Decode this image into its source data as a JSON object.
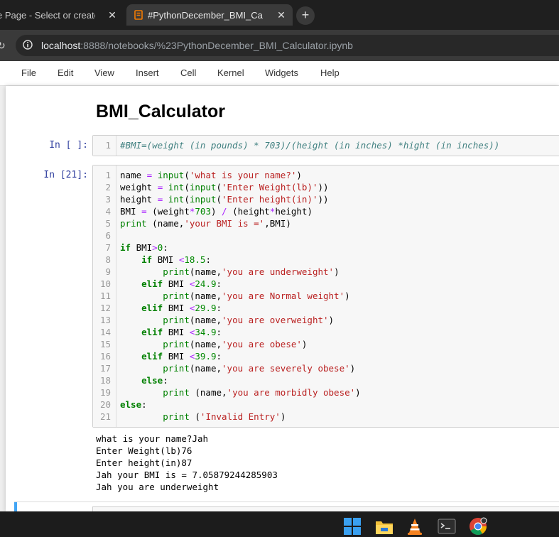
{
  "browser": {
    "tabs": [
      {
        "title": "e Page - Select or create a",
        "close": "✕"
      },
      {
        "title": "#PythonDecember_BMI_Calculat",
        "close": "✕"
      }
    ],
    "new_tab": "+",
    "url_host": "localhost",
    "url_rest": ":8888/notebooks/%23PythonDecember_BMI_Calculator.ipynb"
  },
  "menu": [
    "File",
    "Edit",
    "View",
    "Insert",
    "Cell",
    "Kernel",
    "Widgets",
    "Help"
  ],
  "notebook": {
    "heading": "BMI_Calculator",
    "cell1": {
      "prompt": "In [ ]:",
      "line_number": "1",
      "code": "#BMI=(weight (in pounds) * 703)/(height (in inches) *hight (in inches))"
    },
    "cell2": {
      "prompt": "In [21]:",
      "lines": [
        "name = input('what is your name?')",
        "weight = int(input('Enter Weight(lb)'))",
        "height = int(input('Enter height(in)'))",
        "BMI = (weight*703) / (height*height)",
        "print (name,'your BMI is =',BMI)",
        "",
        "if BMI>0:",
        "    if BMI <18.5:",
        "        print(name,'you are underweight')",
        "    elif BMI <24.9:",
        "        print(name,'you are Normal weight')",
        "    elif BMI <29.9:",
        "        print(name,'you are overweight')",
        "    elif BMI <34.9:",
        "        print(name,'you are obese')",
        "    elif BMI <39.9:",
        "        print(name,'you are severely obese')",
        "    else:",
        "        print (name,'you are morbidly obese')",
        "else:",
        "        print ('Invalid Entry')"
      ],
      "output": [
        "what is your name?Jah",
        "Enter Weight(lb)76",
        "Enter height(in)87",
        "Jah your BMI is = 7.05879244285903",
        "Jah you are underweight"
      ]
    }
  },
  "taskbar": {
    "icons": [
      "windows-start-icon",
      "file-explorer-icon",
      "vlc-icon",
      "terminal-icon",
      "chrome-icon"
    ]
  }
}
